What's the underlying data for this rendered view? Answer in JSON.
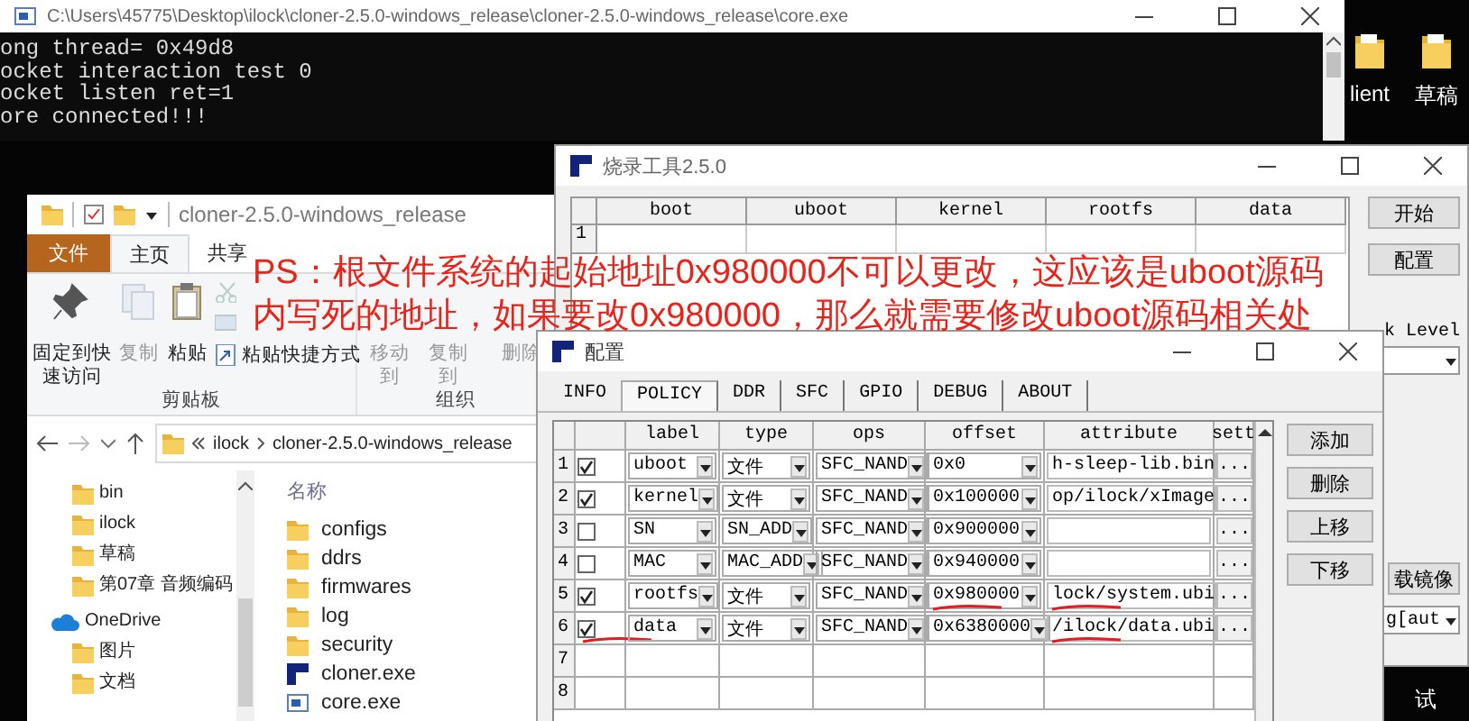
{
  "console": {
    "title": "C:\\Users\\45775\\Desktop\\ilock\\cloner-2.5.0-windows_release\\cloner-2.5.0-windows_release\\core.exe",
    "lines": [
      "ong thread= 0x49d8",
      "ocket interaction test 0",
      "ocket listen ret=1",
      "ore connected!!!"
    ]
  },
  "desktop_items": [
    {
      "label": "lient",
      "kind": "folder"
    },
    {
      "label": "草稿",
      "kind": "folder"
    },
    {
      "label": "试",
      "kind": "text"
    }
  ],
  "explorer": {
    "title": "cloner-2.5.0-windows_release",
    "tabs": [
      {
        "label": "文件",
        "kind": "file",
        "selected": false
      },
      {
        "label": "主页",
        "kind": "tab",
        "selected": true
      },
      {
        "label": "共享",
        "kind": "tab",
        "selected": false
      }
    ],
    "groups": [
      {
        "label": "剪贴板",
        "buttons": [
          {
            "label": "固定到快速访问",
            "kind": "pin",
            "disabled": false
          },
          {
            "label": "复制",
            "kind": "copy",
            "disabled": true
          },
          {
            "label": "粘贴",
            "kind": "paste",
            "disabled": false
          },
          {
            "kind": "cut",
            "disabled": true
          },
          {
            "kind": "copy-path",
            "disabled": true
          },
          {
            "label": "粘贴快捷方式",
            "kind": "shortcut",
            "disabled": false
          }
        ]
      },
      {
        "label": "组织",
        "buttons": [
          {
            "label": "移动到",
            "kind": "move",
            "disabled": true
          },
          {
            "label": "复制到",
            "kind": "copy-to",
            "disabled": true
          },
          {
            "label": "删除",
            "kind": "delete",
            "disabled": true
          }
        ]
      }
    ],
    "address": [
      "ilock",
      "cloner-2.5.0-windows_release"
    ],
    "nav_items": [
      {
        "label": "bin",
        "kind": "folder"
      },
      {
        "label": "ilock",
        "kind": "folder"
      },
      {
        "label": "草稿",
        "kind": "folder"
      },
      {
        "label": "第07章 音频编码",
        "kind": "folder"
      },
      {
        "label": "OneDrive",
        "kind": "cloud"
      },
      {
        "label": "图片",
        "kind": "folder"
      },
      {
        "label": "文档",
        "kind": "folder"
      }
    ],
    "column_header": "名称",
    "files": [
      {
        "name": "configs",
        "kind": "folder"
      },
      {
        "name": "ddrs",
        "kind": "folder"
      },
      {
        "name": "firmwares",
        "kind": "folder"
      },
      {
        "name": "log",
        "kind": "folder"
      },
      {
        "name": "security",
        "kind": "folder"
      },
      {
        "name": "cloner.exe",
        "kind": "app"
      },
      {
        "name": "core.exe",
        "kind": "console"
      }
    ]
  },
  "tool": {
    "title": "烧录工具2.5.0",
    "columns": [
      "boot",
      "uboot",
      "kernel",
      "rootfs",
      "data"
    ],
    "row_numbers": [
      "1"
    ],
    "buttons": [
      "开始",
      "配置"
    ],
    "level_label": "k Level",
    "image_button": "载镜像",
    "mode_select": "g[aut"
  },
  "config": {
    "title": "配置",
    "tabs": [
      {
        "label": "INFO",
        "selected": false
      },
      {
        "label": "POLICY",
        "selected": true
      },
      {
        "label": "DDR",
        "selected": false
      },
      {
        "label": "SFC",
        "selected": false
      },
      {
        "label": "GPIO",
        "selected": false
      },
      {
        "label": "DEBUG",
        "selected": false
      },
      {
        "label": "ABOUT",
        "selected": false
      }
    ],
    "columns": [
      "label",
      "type",
      "ops",
      "offset",
      "attribute",
      "sett"
    ],
    "rows": [
      {
        "num": "1",
        "checked": true,
        "label": "uboot",
        "type": "文件",
        "ops": "SFC_NAND",
        "offset": "0x0",
        "attribute": "h-sleep-lib.bin",
        "setting": "...",
        "check_underlined": false,
        "offset_underlined": false,
        "attribute_underlined": false
      },
      {
        "num": "2",
        "checked": true,
        "label": "kernel",
        "type": "文件",
        "ops": "SFC_NAND",
        "offset": "0x100000",
        "attribute": "op/ilock/xImage",
        "setting": "...",
        "check_underlined": false,
        "offset_underlined": false,
        "attribute_underlined": false
      },
      {
        "num": "3",
        "checked": false,
        "label": "SN",
        "type": "SN_ADD",
        "ops": "SFC_NAND",
        "offset": "0x900000",
        "setting": "...",
        "check_underlined": false,
        "offset_underlined": false,
        "attribute_underlined": false
      },
      {
        "num": "4",
        "checked": false,
        "label": "MAC",
        "type": "MAC_ADD",
        "ops": "SFC_NAND",
        "offset": "0x940000",
        "setting": "...",
        "check_underlined": false,
        "offset_underlined": false,
        "attribute_underlined": false
      },
      {
        "num": "5",
        "checked": true,
        "label": "rootfs",
        "type": "文件",
        "ops": "SFC_NAND",
        "offset": "0x980000",
        "attribute": "lock/system.ubi",
        "setting": "...",
        "check_underlined": false,
        "offset_underlined": true,
        "attribute_underlined": true
      },
      {
        "num": "6",
        "checked": true,
        "label": "data",
        "type": "文件",
        "ops": "SFC_NAND",
        "offset": "0x6380000",
        "attribute": "/ilock/data.ubi",
        "setting": "...",
        "check_underlined": true,
        "offset_underlined": false,
        "attribute_underlined": true
      }
    ],
    "empty_rows": [
      "7",
      "8"
    ],
    "buttons": [
      "添加",
      "删除",
      "上移",
      "下移"
    ]
  },
  "annotation": [
    "PS：根文件系统的起始地址0x980000不可以更改，这应该是uboot源码",
    "内写死的地址，如果要改0x980000，那么就需要修改uboot源码相关处"
  ]
}
